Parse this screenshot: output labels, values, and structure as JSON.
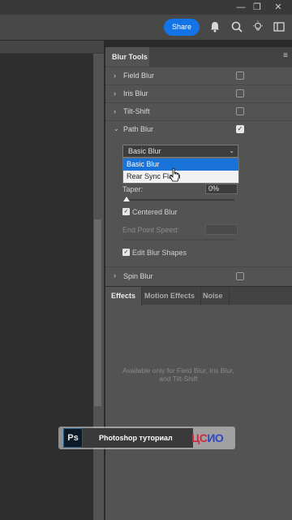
{
  "toolbar": {
    "share_label": "Share",
    "icons": [
      "bell-icon",
      "search-icon",
      "lightbulb-icon",
      "workspace-icon"
    ]
  },
  "window": {
    "buttons": [
      "minimize",
      "restore",
      "close"
    ]
  },
  "panel": {
    "title": "Blur Tools",
    "items": [
      {
        "label": "Field Blur",
        "checked": false,
        "expanded": false
      },
      {
        "label": "Iris Blur",
        "checked": false,
        "expanded": false
      },
      {
        "label": "Tilt-Shift",
        "checked": false,
        "expanded": false
      },
      {
        "label": "Path Blur",
        "checked": true,
        "expanded": true
      },
      {
        "label": "Spin Blur",
        "checked": false,
        "expanded": false
      }
    ],
    "path_blur": {
      "selected": "Basic Blur",
      "options": [
        "Basic Blur",
        "Rear Sync Flash"
      ],
      "taper_label": "Taper:",
      "taper_value": "0%",
      "centered_blur_label": "Centered Blur",
      "end_point_speed_label": "End Point Speed:",
      "edit_blur_shapes_label": "Edit Blur Shapes"
    }
  },
  "tabs": [
    "Effects",
    "Motion Effects",
    "Noise"
  ],
  "effects_note": "Available only for Field Blur, Iris Blur, and Tilt-Shift",
  "banner": {
    "logo": "Ps",
    "text": "Photoshop туториал",
    "brand_a": "ЦС",
    "brand_b": "ИО"
  },
  "colors": {
    "accent": "#1473e6",
    "selection": "#1a73d9",
    "panel": "#535353"
  }
}
